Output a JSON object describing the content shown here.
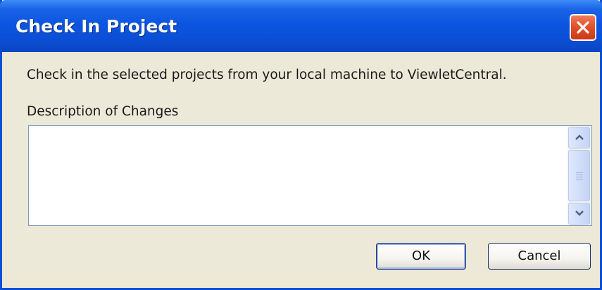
{
  "dialog": {
    "title": "Check In Project",
    "message": "Check in the selected projects from your local machine to ViewletCentral.",
    "description_label": "Description of Changes",
    "description_value": "",
    "buttons": {
      "ok": "OK",
      "cancel": "Cancel"
    }
  },
  "icons": {
    "close": "close-icon",
    "scroll_up": "chevron-up-icon",
    "scroll_down": "chevron-down-icon"
  },
  "colors": {
    "titlebar": "#0b4fd6",
    "dialog_bg": "#ece9d8",
    "close_button": "#e3522c"
  }
}
